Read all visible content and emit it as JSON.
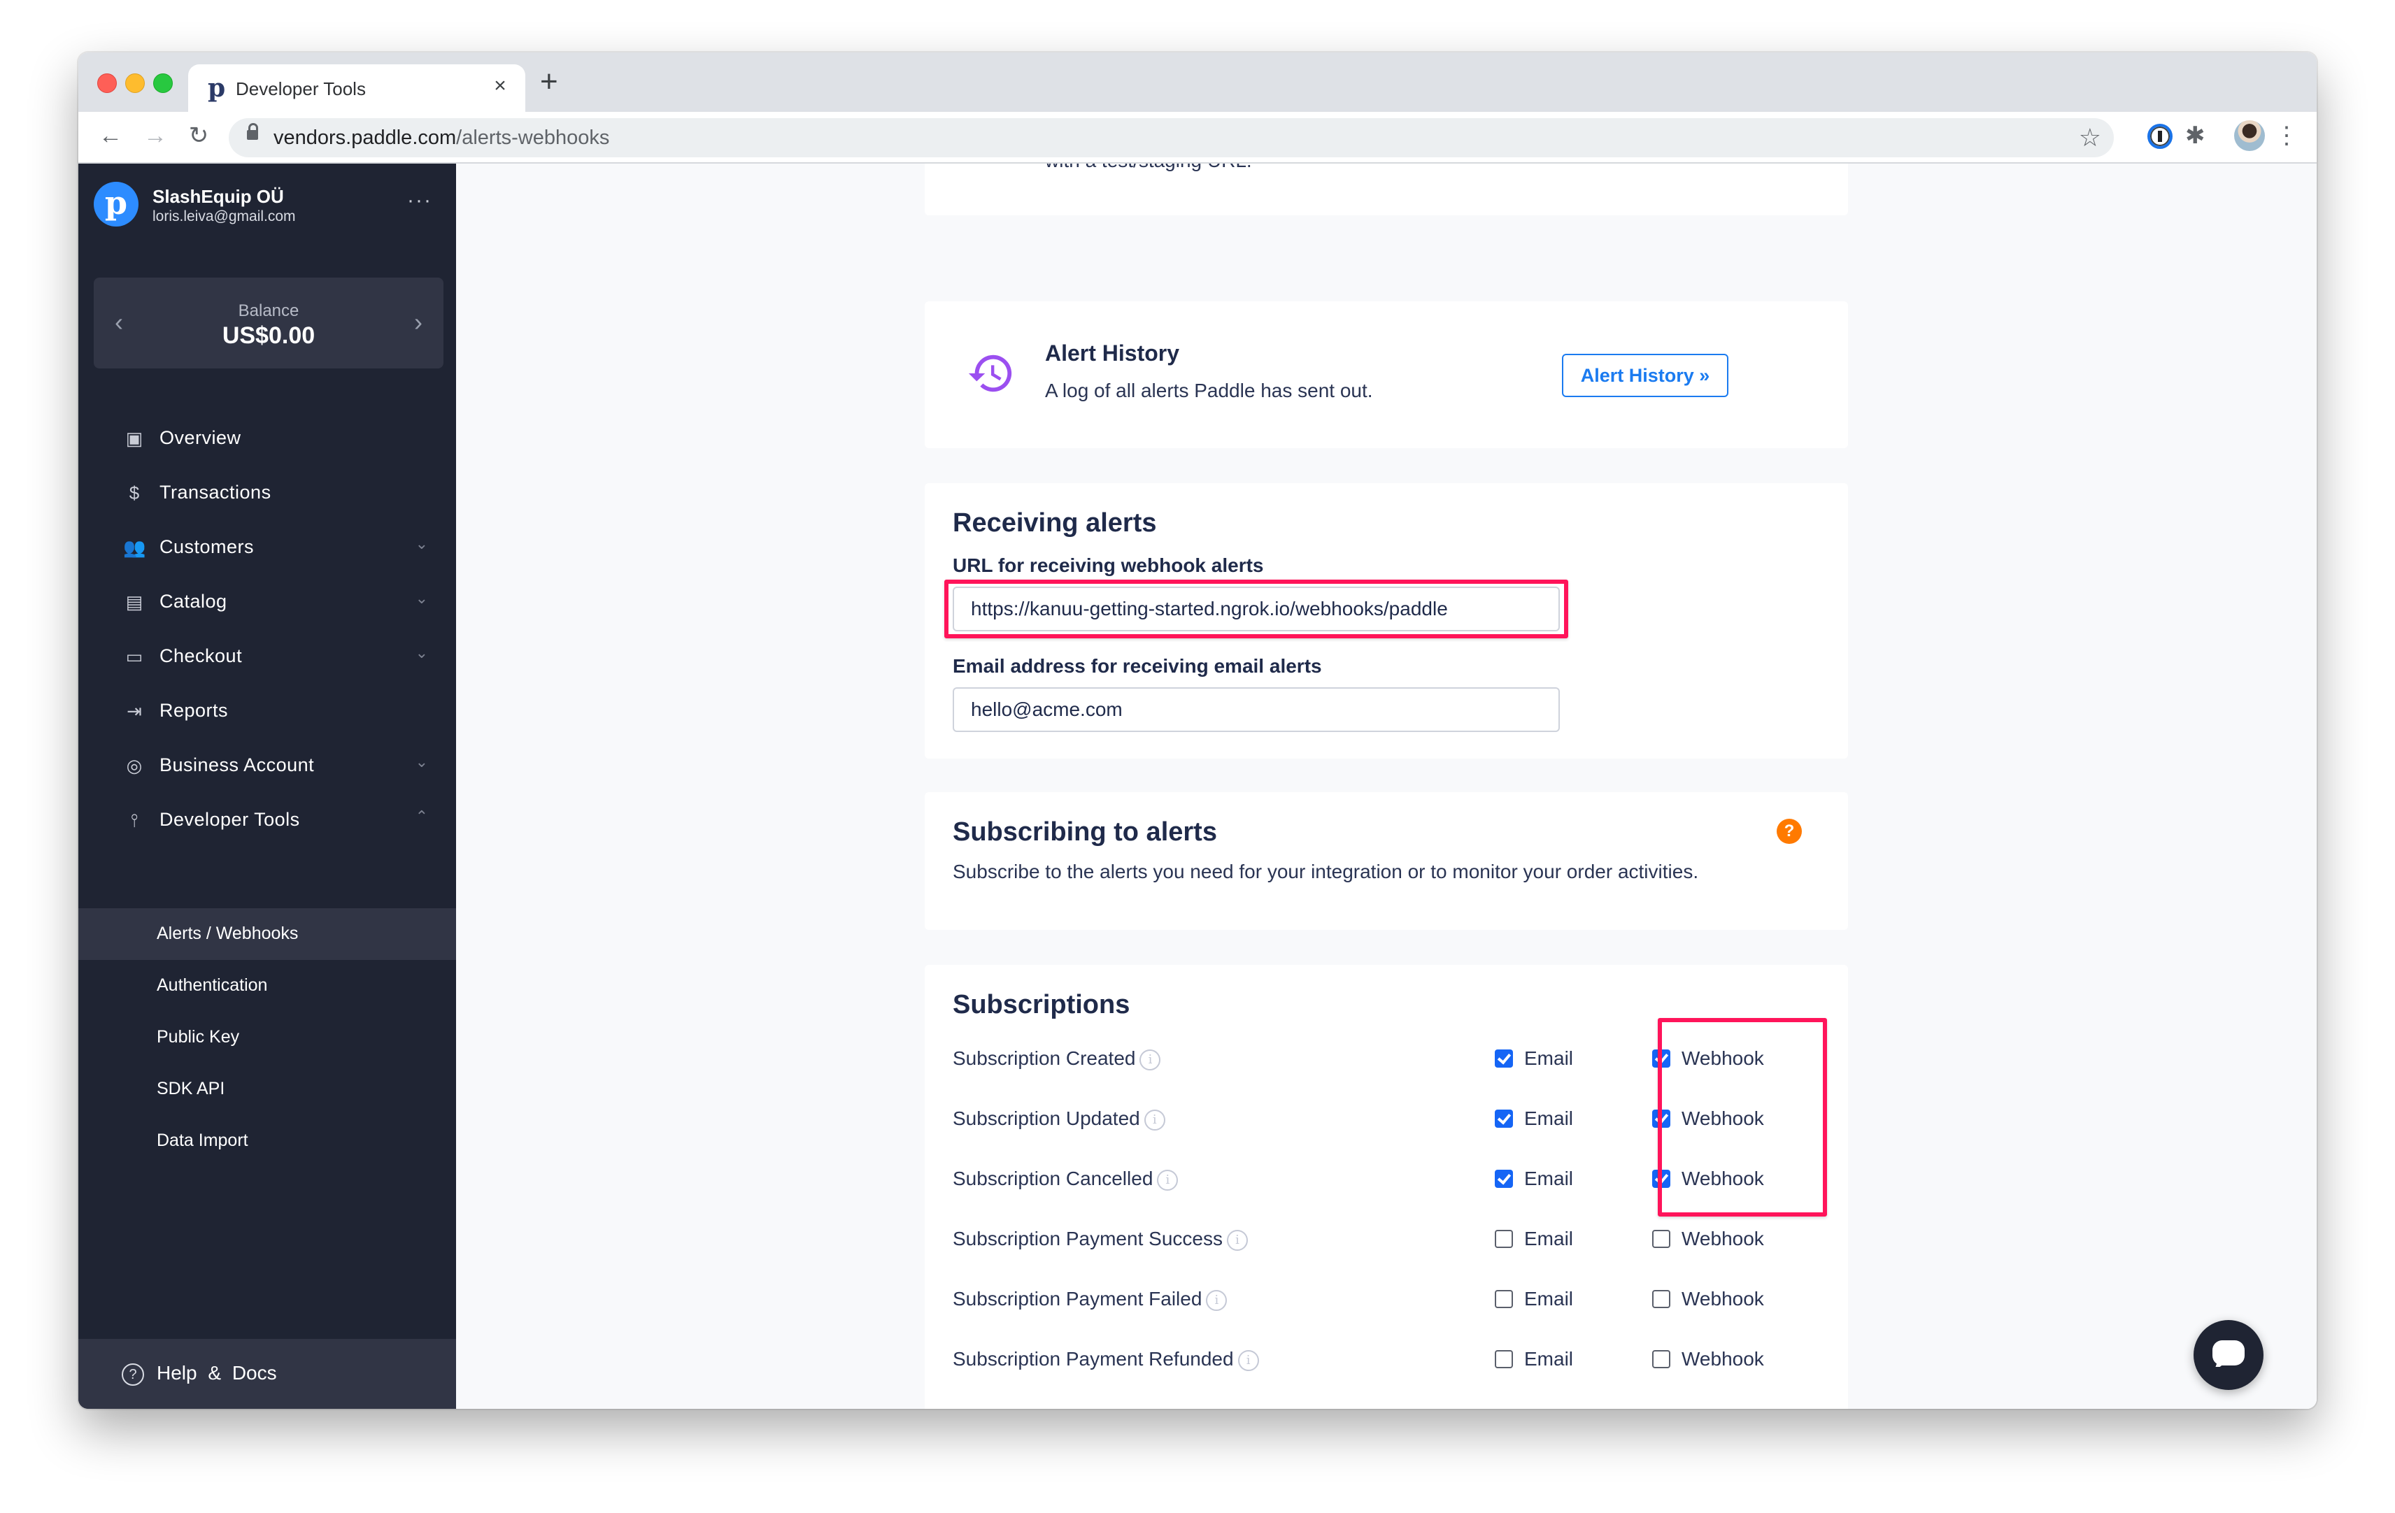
{
  "browser": {
    "tab_title": "Developer Tools",
    "tab_favicon": "p",
    "tab_close": "×",
    "new_tab": "+",
    "url_host": "vendors.paddle.com",
    "url_path": "/alerts-webhooks",
    "icons": {
      "back": "←",
      "forward": "→",
      "reload": "↻",
      "star": "☆",
      "puzzle": "✱",
      "menu": "⋮"
    }
  },
  "sidebar": {
    "logo_letter": "p",
    "account_name": "SlashEquip OÜ",
    "account_email": "loris.leiva@gmail.com",
    "more": "···",
    "balance": {
      "label": "Balance",
      "value": "US$0.00",
      "prev": "‹",
      "next": "›"
    },
    "items": [
      {
        "label": "Overview",
        "icon": "▣",
        "chevron": ""
      },
      {
        "label": "Transactions",
        "icon": "$",
        "chevron": ""
      },
      {
        "label": "Customers",
        "icon": "👥",
        "chevron": "⌄"
      },
      {
        "label": "Catalog",
        "icon": "▤",
        "chevron": "⌄"
      },
      {
        "label": "Checkout",
        "icon": "▭",
        "chevron": "⌄"
      },
      {
        "label": "Reports",
        "icon": "⇥",
        "chevron": ""
      },
      {
        "label": "Business Account",
        "icon": "◎",
        "chevron": "⌄"
      },
      {
        "label": "Developer Tools",
        "icon": "⫯",
        "chevron": "⌃"
      }
    ],
    "sub_items": [
      {
        "label": "Alerts / Webhooks",
        "active": true
      },
      {
        "label": "Authentication",
        "active": false
      },
      {
        "label": "Public Key",
        "active": false
      },
      {
        "label": "SDK API",
        "active": false
      },
      {
        "label": "Data Import",
        "active": false
      }
    ],
    "help_icon": "?",
    "help_label": "Help & Docs"
  },
  "main": {
    "cut_off_text": "with a test/staging URL.",
    "alert_history": {
      "title": "Alert History",
      "description": "A log of all alerts Paddle has sent out.",
      "button": "Alert History »"
    },
    "receiving": {
      "title": "Receiving alerts",
      "webhook_label": "URL for receiving webhook alerts",
      "webhook_value": "https://kanuu-getting-started.ngrok.io/webhooks/paddle",
      "email_label": "Email address for receiving email alerts",
      "email_value": "hello@acme.com"
    },
    "subscribing": {
      "title": "Subscribing to alerts",
      "description": "Subscribe to the alerts you need for your integration or to monitor your order activities.",
      "help_badge": "?"
    },
    "subscriptions": {
      "title": "Subscriptions",
      "email_label": "Email",
      "webhook_label": "Webhook",
      "info_glyph": "i",
      "rows": [
        {
          "label": "Subscription Created",
          "email": true,
          "webhook": true
        },
        {
          "label": "Subscription Updated",
          "email": true,
          "webhook": true
        },
        {
          "label": "Subscription Cancelled",
          "email": true,
          "webhook": true
        },
        {
          "label": "Subscription Payment Success",
          "email": false,
          "webhook": false
        },
        {
          "label": "Subscription Payment Failed",
          "email": false,
          "webhook": false
        },
        {
          "label": "Subscription Payment Refunded",
          "email": false,
          "webhook": false
        }
      ]
    }
  },
  "colors": {
    "sidebar_bg": "#1f2433",
    "sidebar_active": "#313545",
    "accent_blue": "#1b7bf0",
    "checkbox_blue": "#1565f5",
    "highlight_pink": "#ff145a",
    "help_orange": "#ff7a00",
    "history_purple": "#9b4ff0"
  }
}
